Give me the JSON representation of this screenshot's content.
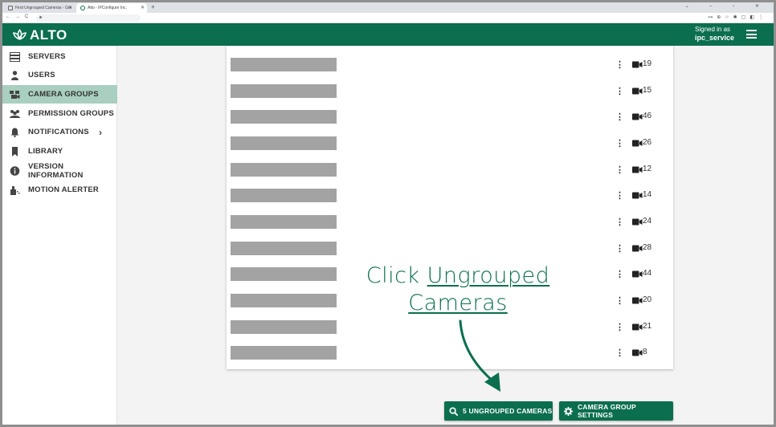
{
  "browser": {
    "tabs": [
      {
        "label": "Find Ungrouped Cameras - Gm"
      },
      {
        "label": "Alto - IPConfigure Inc."
      }
    ]
  },
  "header": {
    "logo_text": "ALTO",
    "signed_in_label": "Signed in as",
    "username": "ipc_service"
  },
  "sidebar": {
    "items": [
      {
        "label": "SERVERS",
        "icon": "servers-icon"
      },
      {
        "label": "USERS",
        "icon": "user-icon"
      },
      {
        "label": "CAMERA GROUPS",
        "icon": "camera-group-icon",
        "active": true
      },
      {
        "label": "PERMISSION GROUPS",
        "icon": "people-icon"
      },
      {
        "label": "NOTIFICATIONS",
        "icon": "bell-icon",
        "has_submenu": true
      },
      {
        "label": "LIBRARY",
        "icon": "bookmark-icon"
      },
      {
        "label": "VERSION INFORMATION",
        "icon": "info-icon"
      },
      {
        "label": "MOTION ALERTER",
        "icon": "motion-icon"
      }
    ],
    "chevron": "›"
  },
  "camera_groups": [
    {
      "count": "19"
    },
    {
      "count": "15"
    },
    {
      "count": "46"
    },
    {
      "count": "26"
    },
    {
      "count": "12"
    },
    {
      "count": "14"
    },
    {
      "count": "24"
    },
    {
      "count": "28"
    },
    {
      "count": "44"
    },
    {
      "count": "20"
    },
    {
      "count": "21"
    },
    {
      "count": "8"
    }
  ],
  "callout": {
    "prefix": "Click ",
    "line1_link": "Ungrouped",
    "line2_link": "Cameras"
  },
  "actions": {
    "ungrouped_label": "5 UNGROUPED CAMERAS",
    "settings_label": "CAMERA GROUP SETTINGS"
  },
  "colors": {
    "brand": "#0b6e4f",
    "active_item": "#a8cfbf",
    "redacted": "#a3a3a3"
  }
}
